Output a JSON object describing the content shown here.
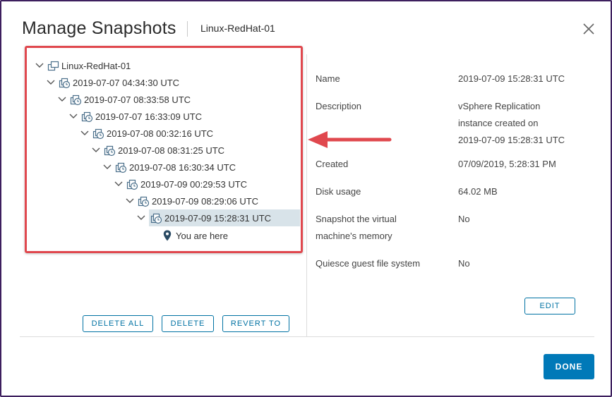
{
  "dialog": {
    "title": "Manage Snapshots",
    "subtitle": "Linux-RedHat-01",
    "close_icon": "close-icon"
  },
  "tree": {
    "root": "Linux-RedHat-01",
    "snapshots": [
      "2019-07-07 04:34:30 UTC",
      "2019-07-07 08:33:58 UTC",
      "2019-07-07 16:33:09 UTC",
      "2019-07-08 00:32:16 UTC",
      "2019-07-08 08:31:25 UTC",
      "2019-07-08 16:30:34 UTC",
      "2019-07-09 00:29:53 UTC",
      "2019-07-09 08:29:06 UTC",
      "2019-07-09 15:28:31 UTC"
    ],
    "selected_index": 8,
    "you_are_here": "You are here"
  },
  "actions": {
    "delete_all": "DELETE ALL",
    "delete": "DELETE",
    "revert_to": "REVERT TO",
    "edit": "EDIT",
    "done": "DONE"
  },
  "details": {
    "name_label": "Name",
    "name_value": "2019-07-09 15:28:31 UTC",
    "description_label": "Description",
    "description_line1": "vSphere Replication",
    "description_line2": "instance created on",
    "description_line3": "2019-07-09 15:28:31 UTC",
    "created_label": "Created",
    "created_value": "07/09/2019, 5:28:31 PM",
    "disk_usage_label": "Disk usage",
    "disk_usage_value": "64.02 MB",
    "memory_label_line1": "Snapshot the virtual",
    "memory_label_line2": "machine's memory",
    "memory_value": "No",
    "quiesce_label": "Quiesce guest file system",
    "quiesce_value": "No"
  },
  "colors": {
    "accent": "#0079b8",
    "highlight_border": "#e0484e",
    "selected_row": "#d8e3e9"
  }
}
